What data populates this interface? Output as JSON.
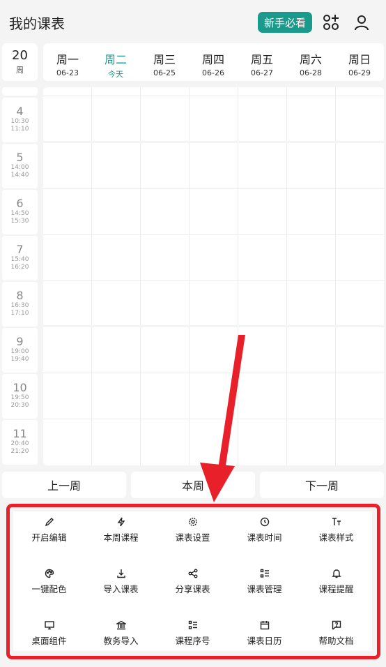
{
  "header": {
    "title": "我的课表",
    "newbie_label": "新手必看",
    "add_icon": "add-widgets-icon",
    "user_icon": "user-icon"
  },
  "week": {
    "number": "20",
    "unit": "周"
  },
  "days": [
    {
      "name": "周一",
      "date": "06-23",
      "today": false
    },
    {
      "name": "周二",
      "date": "今天",
      "today": true
    },
    {
      "name": "周三",
      "date": "06-25",
      "today": false
    },
    {
      "name": "周四",
      "date": "06-26",
      "today": false
    },
    {
      "name": "周五",
      "date": "06-27",
      "today": false
    },
    {
      "name": "周六",
      "date": "06-28",
      "today": false
    },
    {
      "name": "周日",
      "date": "06-29",
      "today": false
    }
  ],
  "periods": [
    {
      "num": "4",
      "start": "10:30",
      "end": "11:10"
    },
    {
      "num": "5",
      "start": "14:00",
      "end": "14:40"
    },
    {
      "num": "6",
      "start": "14:50",
      "end": "15:30"
    },
    {
      "num": "7",
      "start": "15:40",
      "end": "16:20"
    },
    {
      "num": "8",
      "start": "16:30",
      "end": "17:10"
    },
    {
      "num": "9",
      "start": "19:00",
      "end": "19:40"
    },
    {
      "num": "10",
      "start": "19:50",
      "end": "20:30"
    },
    {
      "num": "11",
      "start": "20:40",
      "end": "21:20"
    }
  ],
  "nav": {
    "prev": "上一周",
    "current": "本周",
    "next": "下一周"
  },
  "menu": [
    {
      "label": "开启编辑",
      "icon": "pencil-icon"
    },
    {
      "label": "本周课程",
      "icon": "lightning-icon"
    },
    {
      "label": "课表设置",
      "icon": "gear-icon"
    },
    {
      "label": "课表时间",
      "icon": "clock-icon"
    },
    {
      "label": "课表样式",
      "icon": "text-style-icon"
    },
    {
      "label": "一键配色",
      "icon": "palette-icon"
    },
    {
      "label": "导入课表",
      "icon": "download-icon"
    },
    {
      "label": "分享课表",
      "icon": "share-icon"
    },
    {
      "label": "课表管理",
      "icon": "list-manage-icon"
    },
    {
      "label": "课程提醒",
      "icon": "bell-icon"
    },
    {
      "label": "桌面组件",
      "icon": "monitor-icon"
    },
    {
      "label": "教务导入",
      "icon": "institution-icon"
    },
    {
      "label": "课程序号",
      "icon": "list-number-icon"
    },
    {
      "label": "课表日历",
      "icon": "calendar-icon"
    },
    {
      "label": "帮助文档",
      "icon": "help-doc-icon"
    }
  ],
  "colors": {
    "accent": "#1a9a8a",
    "highlight": "#e8202a"
  }
}
